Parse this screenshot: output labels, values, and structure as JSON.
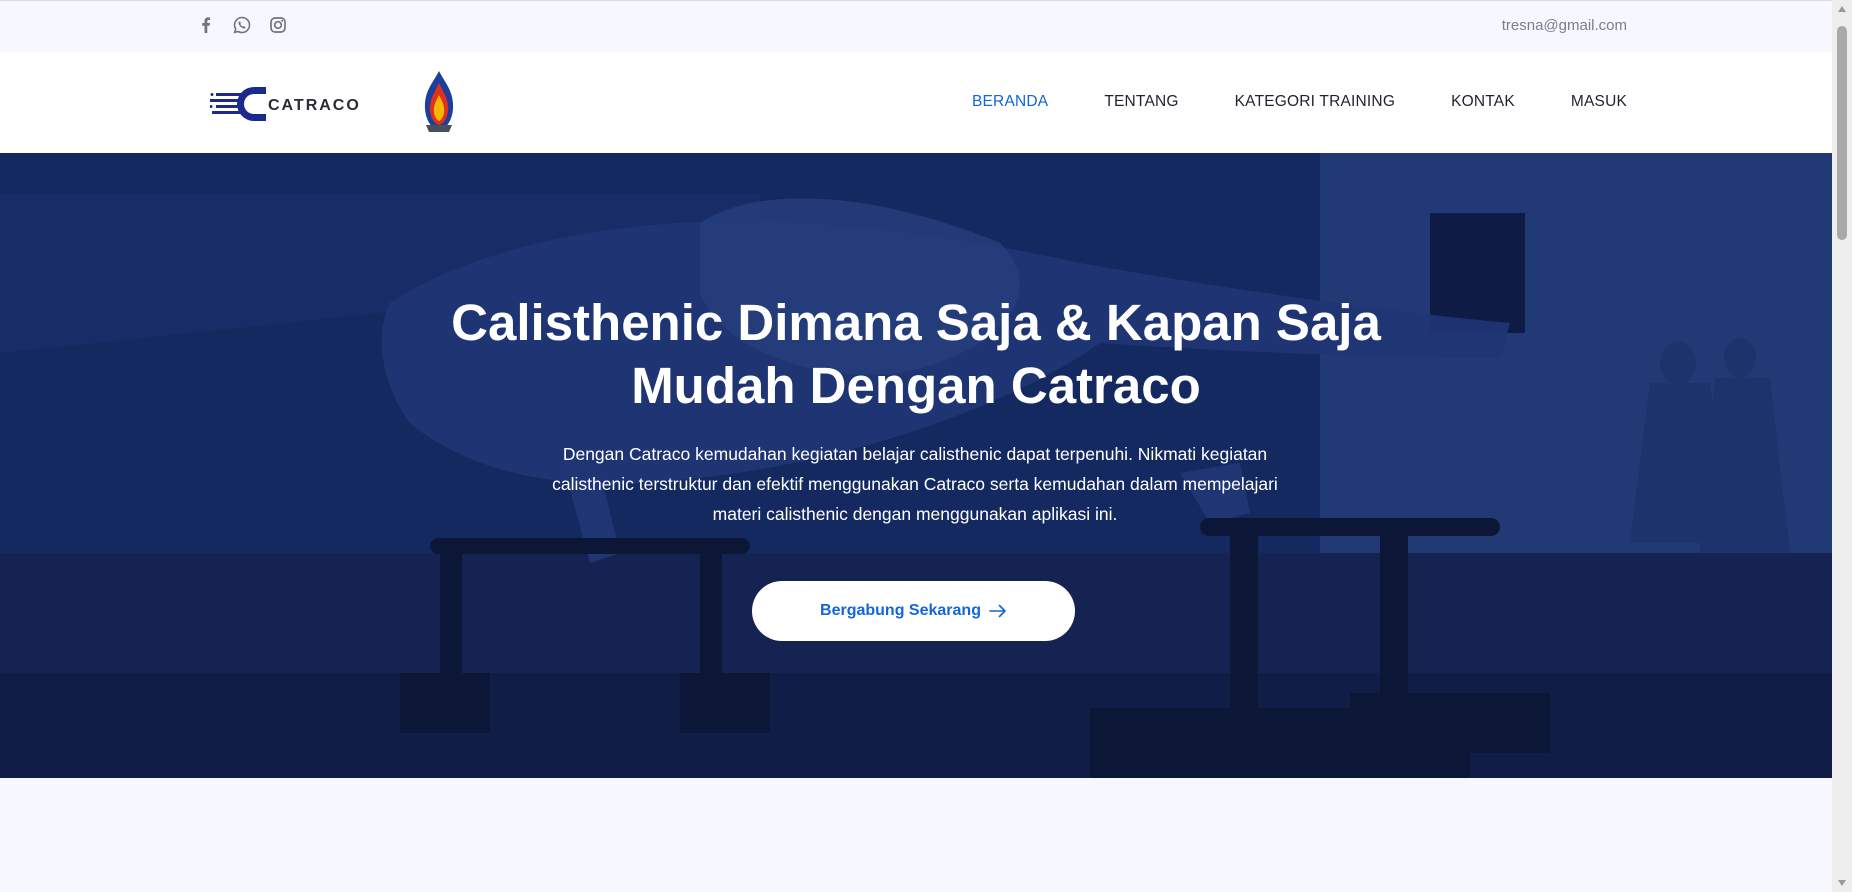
{
  "topbar": {
    "email": "tresna@gmail.com",
    "social": [
      {
        "name": "facebook-icon"
      },
      {
        "name": "whatsapp-icon"
      },
      {
        "name": "instagram-icon"
      }
    ]
  },
  "brand": {
    "logo_text": "CATRACO"
  },
  "nav": {
    "items": [
      {
        "label": "BERANDA",
        "active": true
      },
      {
        "label": "TENTANG",
        "active": false
      },
      {
        "label": "KATEGORI TRAINING",
        "active": false
      },
      {
        "label": "KONTAK",
        "active": false
      },
      {
        "label": "MASUK",
        "active": false
      }
    ]
  },
  "hero": {
    "title_line1": "Calisthenic Dimana Saja & Kapan Saja",
    "title_line2": "Mudah Dengan Catraco",
    "description": "Dengan Catraco kemudahan kegiatan belajar calisthenic dapat terpenuhi. Nikmati kegiatan calisthenic terstruktur dan efektif menggunakan Catraco serta kemudahan dalam mempelajari materi calisthenic dengan menggunakan aplikasi ini.",
    "cta_label": "Bergabung Sekarang"
  },
  "colors": {
    "accent": "#1266d9",
    "hero_overlay": "#1c3677",
    "page_background": "#f7f8ff"
  }
}
